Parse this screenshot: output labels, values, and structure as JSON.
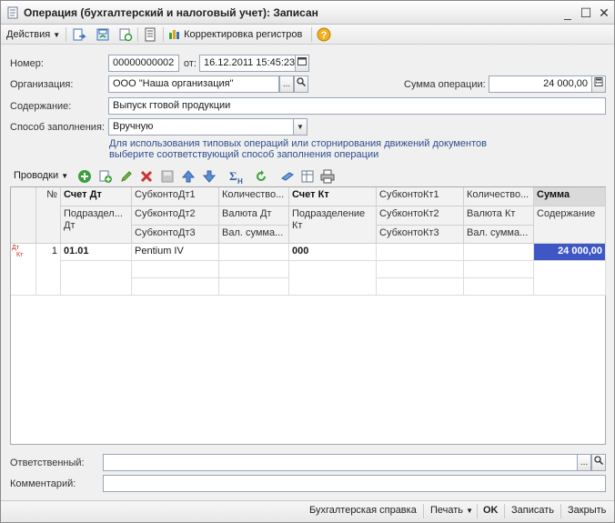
{
  "window": {
    "title": "Операция (бухгалтерский и налоговый учет): Записан",
    "minimize": "_",
    "maximize": "☐",
    "close": "✕"
  },
  "toolbar": {
    "actions_label": "Действия",
    "correction_label": "Корректировка регистров"
  },
  "form": {
    "number_label": "Номер:",
    "number_value": "00000000002",
    "date_label": "от:",
    "date_value": "16.12.2011 15:45:23",
    "org_label": "Организация:",
    "org_value": "ООО \"Наша организация\"",
    "sum_label": "Сумма операции:",
    "sum_value": "24 000,00",
    "content_label": "Содержание:",
    "content_value": "Выпуск гтовой продукции",
    "fill_label": "Способ заполнения:",
    "fill_value": "Вручную",
    "hint_line1": "Для использования типовых операций или сторнирования движений документов",
    "hint_line2": "выберите соответствующий способ заполнения операции"
  },
  "entries_bar": {
    "label": "Проводки"
  },
  "table": {
    "headers": {
      "no": "№",
      "acc_dt": "Счет Дт",
      "sub_dt1": "СубконтоДт1",
      "qty_dt": "Количество...",
      "acc_kt": "Счет Кт",
      "sub_kt1": "СубконтоКт1",
      "qty_kt": "Количество...",
      "sum": "Сумма",
      "dept_dt": "Подраздел... Дт",
      "sub_dt2": "СубконтоДт2",
      "cur_dt": "Валюта Дт",
      "dept_kt": "Подразделение Кт",
      "sub_kt2": "СубконтоКт2",
      "cur_kt": "Валюта Кт",
      "content": "Содержание",
      "sub_dt3": "СубконтоДт3",
      "cursum_dt": "Вал. сумма...",
      "sub_kt3": "СубконтоКт3",
      "cursum_kt": "Вал. сумма..."
    },
    "rows": [
      {
        "icon_text_top": "Дт",
        "icon_text_bottom": "Кт",
        "no": "1",
        "acc_dt": "01.01",
        "sub_dt1": "Pentium IV",
        "acc_kt": "000",
        "sum": "24 000,00"
      }
    ]
  },
  "footer_fields": {
    "responsible_label": "Ответственный:",
    "responsible_value": "",
    "comment_label": "Комментарий:",
    "comment_value": ""
  },
  "bottom": {
    "report": "Бухгалтерская справка",
    "print": "Печать",
    "ok": "OK",
    "save": "Записать",
    "close": "Закрыть"
  },
  "colors": {
    "selection": "#3f57c4",
    "hint": "#2c4e8e",
    "add_green": "#3aa03a",
    "delete_red": "#d03030"
  }
}
